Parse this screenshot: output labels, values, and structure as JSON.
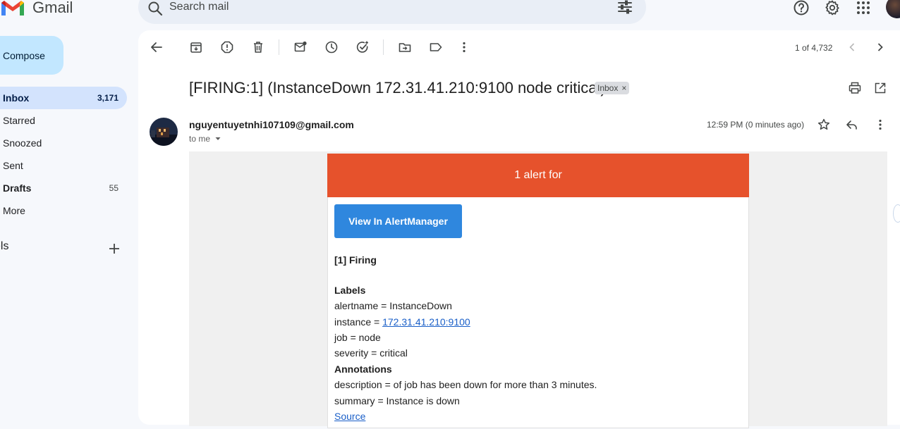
{
  "app": {
    "name": "Gmail"
  },
  "search": {
    "placeholder": "Search mail"
  },
  "sidebar": {
    "compose_label": "Compose",
    "items": [
      {
        "label": "Inbox",
        "count": "3,171"
      },
      {
        "label": "Starred",
        "count": ""
      },
      {
        "label": "Snoozed",
        "count": ""
      },
      {
        "label": "Sent",
        "count": ""
      },
      {
        "label": "Drafts",
        "count": "55"
      },
      {
        "label": "More",
        "count": ""
      }
    ],
    "labels_header": "els"
  },
  "toolbar": {
    "paging": "1 of 4,732"
  },
  "message": {
    "subject": "[FIRING:1] (InstanceDown 172.31.41.210:9100 node critical)",
    "chip_label": "Inbox",
    "chip_close": "×",
    "sender": "nguyentuyetnhi107109@gmail.com",
    "recipient": "to me",
    "time": "12:59 PM (0 minutes ago)"
  },
  "email": {
    "header": "1 alert for",
    "button": "View In AlertManager",
    "firing": "[1] Firing",
    "labels_title": "Labels",
    "alertname": "alertname = InstanceDown",
    "instance_prefix": "instance = ",
    "instance_link": "172.31.41.210:9100",
    "job": "job = node",
    "severity": "severity = critical",
    "annotations_title": "Annotations",
    "description": "description = of job has been down for more than 3 minutes.",
    "summary": "summary = Instance is down",
    "source": "Source"
  },
  "colors": {
    "alert_bar": "#e6522c",
    "button": "#2f87de",
    "compose": "#c2e7ff",
    "inbox_active": "#d3e3fd"
  }
}
